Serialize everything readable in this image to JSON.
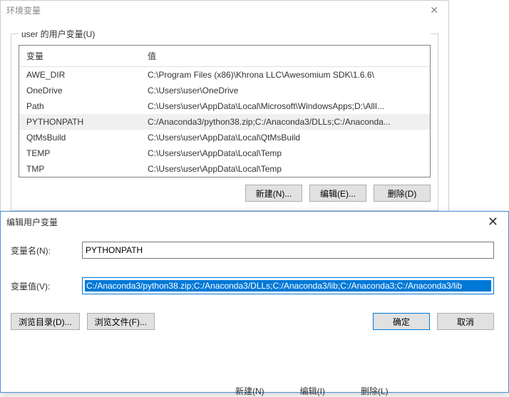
{
  "dialog1": {
    "title": "环境变量",
    "userVarsLegend": "user 的用户变量(U)",
    "columns": {
      "var": "变量",
      "value": "值"
    },
    "rows": [
      {
        "var": "AWE_DIR",
        "value": "C:\\Program Files (x86)\\Khrona LLC\\Awesomium SDK\\1.6.6\\"
      },
      {
        "var": "OneDrive",
        "value": "C:\\Users\\user\\OneDrive"
      },
      {
        "var": "Path",
        "value": "C:\\Users\\user\\AppData\\Local\\Microsoft\\WindowsApps;D:\\AllI..."
      },
      {
        "var": "PYTHONPATH",
        "value": "C:/Anaconda3/python38.zip;C:/Anaconda3/DLLs;C:/Anaconda..."
      },
      {
        "var": "QtMsBuild",
        "value": "C:\\Users\\user\\AppData\\Local\\QtMsBuild"
      },
      {
        "var": "TEMP",
        "value": "C:\\Users\\user\\AppData\\Local\\Temp"
      },
      {
        "var": "TMP",
        "value": "C:\\Users\\user\\AppData\\Local\\Temp"
      }
    ],
    "selectedIndex": 3,
    "buttons": {
      "new": "新建(N)...",
      "edit": "编辑(E)...",
      "delete": "删除(D)"
    }
  },
  "dialog2": {
    "title": "编辑用户变量",
    "nameLabel": "变量名(N):",
    "nameValue": "PYTHONPATH",
    "valueLabel": "变量值(V):",
    "valueValue": "C:/Anaconda3/python38.zip;C:/Anaconda3/DLLs;C:/Anaconda3/lib;C:/Anaconda3;C:/Anaconda3/lib",
    "buttons": {
      "browseDir": "浏览目录(D)...",
      "browseFile": "浏览文件(F)...",
      "ok": "确定",
      "cancel": "取消"
    }
  },
  "obscured": {
    "new": "新建(N)",
    "edit": "编辑(I)",
    "delete": "删除(L)"
  }
}
